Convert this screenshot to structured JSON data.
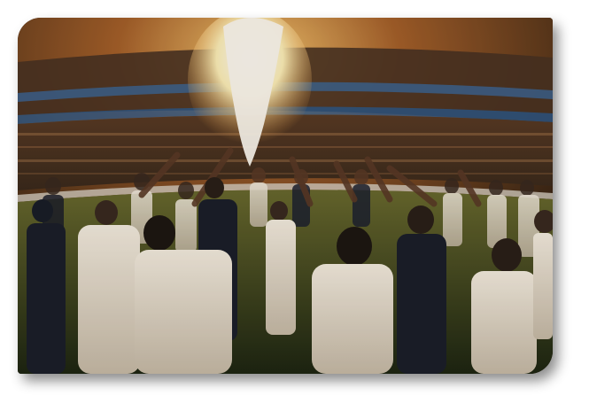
{
  "image": {
    "subject": "cricket-team-huddle-stadium",
    "accent_colors": {
      "flame": "#fff3c4",
      "sky": "#3a2818",
      "grass": "#2f3a1c",
      "kit": "#ece4d6",
      "blazer": "#1c1f2a"
    }
  }
}
